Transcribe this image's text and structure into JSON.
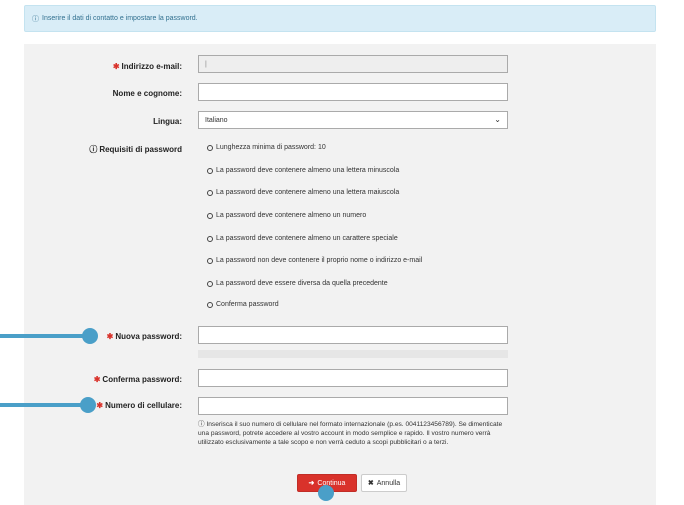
{
  "banner": {
    "icon": "info-circle-icon",
    "text": "Inserire il dati di contatto e impostare la password."
  },
  "form": {
    "email": {
      "label": "Indirizzo e-mail:",
      "value": "|"
    },
    "name": {
      "label": "Nome e cognome:",
      "value": ""
    },
    "language": {
      "label": "Lingua:",
      "value": "Italiano"
    },
    "requirements": {
      "label": "Requisiti di password",
      "items": [
        "Lunghezza minima di password: 10",
        "La password deve contenere almeno una lettera minuscola",
        "La password deve contenere almeno una lettera maiuscola",
        "La password deve contenere almeno un numero",
        "La password deve contenere almeno un carattere speciale",
        "La password non deve contenere il proprio nome o indirizzo e-mail",
        "La password deve essere diversa da quella precedente",
        "Conferma password"
      ]
    },
    "new_password": {
      "label": "Nuova password:",
      "value": ""
    },
    "confirm_password": {
      "label": "Conferma password:",
      "value": ""
    },
    "mobile": {
      "label": "Numero di cellulare:",
      "value": "",
      "help": "Inserisca il suo numero di cellulare nel formato internazionale (p.es. 0041123456789). Se dimenticate una password, potrete accedere al vostro account in modo semplice e rapido. Il vostro numero verrà utilizzato esclusivamente a tale scopo e non verrà ceduto a scopi pubblicitari o a terzi."
    }
  },
  "buttons": {
    "continue": "Continua",
    "cancel": "Annulla"
  },
  "colors": {
    "accent": "#d9322b",
    "banner_bg": "#d9edf7",
    "annotation": "#4a9fc8"
  }
}
